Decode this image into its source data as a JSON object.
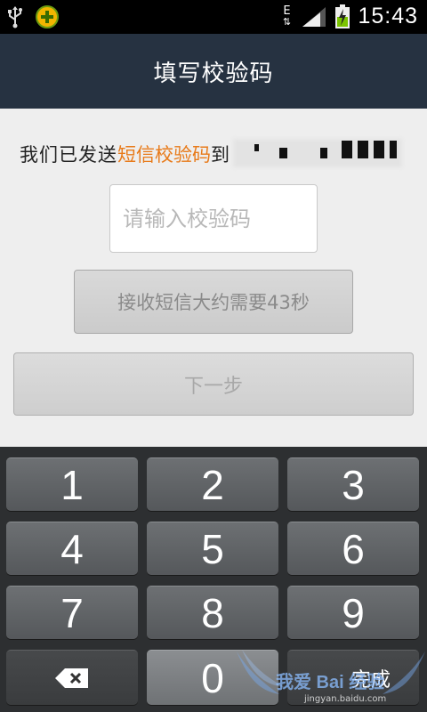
{
  "status_bar": {
    "network_label": "E",
    "time": "15:43"
  },
  "header": {
    "title": "填写校验码"
  },
  "form": {
    "notice_prefix": "我们已发送",
    "notice_highlight": "短信校验码",
    "notice_suffix": "到",
    "code_placeholder": "请输入校验码",
    "code_value": "",
    "sms_button_label": "接收短信大约需要43秒",
    "next_button_label": "下一步"
  },
  "keyboard": {
    "keys": [
      "1",
      "2",
      "3",
      "4",
      "5",
      "6",
      "7",
      "8",
      "9",
      "0"
    ],
    "done_label": "完成",
    "backspace_icon": "backspace-icon"
  },
  "watermark": {
    "text": "我爱 Bai 经验",
    "site": "jingyan.baidu.com"
  },
  "colors": {
    "title_bar": "#263241",
    "highlight": "#e87a19",
    "background": "#eeeeee",
    "keyboard": "#2d2f31"
  }
}
